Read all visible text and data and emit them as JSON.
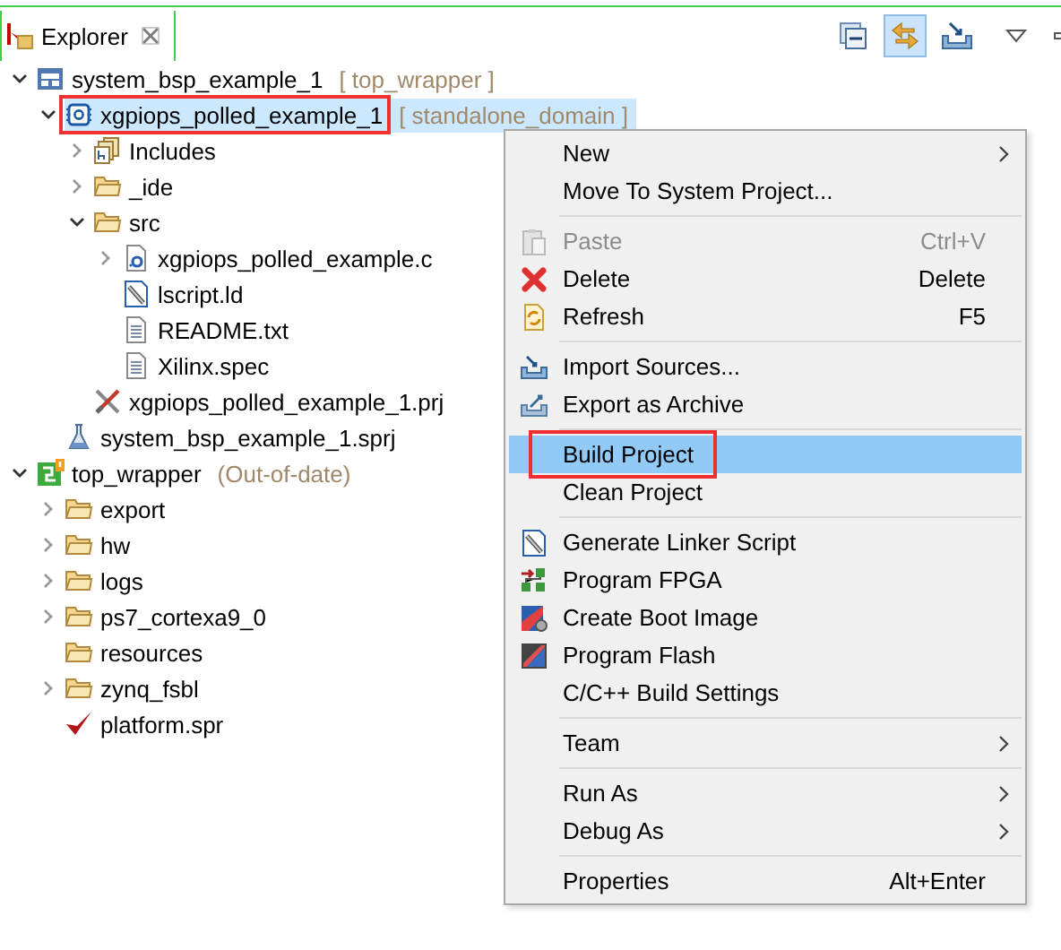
{
  "view_tab": {
    "title": "Explorer",
    "selected": true
  },
  "toolbar": [
    {
      "kind": "collapse",
      "selected": false
    },
    {
      "kind": "link",
      "selected": true
    },
    {
      "kind": "import",
      "selected": false
    },
    {
      "kind": "view-menu",
      "selected": false
    },
    {
      "kind": "minimize",
      "selected": false
    }
  ],
  "tree": [
    {
      "label": "system_bsp_example_1",
      "suffix": "[ top_wrapper ]",
      "kind": "system",
      "expanded": true,
      "selected": false,
      "boxed": false,
      "children": [
        {
          "label": "xgpiops_polled_example_1",
          "suffix": "[ standalone_domain ]",
          "kind": "app",
          "expanded": true,
          "selected": true,
          "boxed": true,
          "children": [
            {
              "label": "Includes",
              "kind": "includes",
              "expanded": false,
              "selected": false,
              "boxed": false
            },
            {
              "label": "_ide",
              "kind": "folder",
              "expanded": false,
              "selected": false,
              "boxed": false
            },
            {
              "label": "src",
              "kind": "folder",
              "expanded": true,
              "selected": false,
              "boxed": false,
              "children": [
                {
                  "label": "xgpiops_polled_example.c",
                  "kind": "c-file",
                  "expanded": false,
                  "selected": false,
                  "boxed": false
                },
                {
                  "label": "lscript.ld",
                  "kind": "linker",
                  "selected": false,
                  "boxed": false
                },
                {
                  "label": "README.txt",
                  "kind": "text",
                  "selected": false,
                  "boxed": false
                },
                {
                  "label": "Xilinx.spec",
                  "kind": "text",
                  "selected": false,
                  "boxed": false
                }
              ]
            },
            {
              "label": "xgpiops_polled_example_1.prj",
              "kind": "tools",
              "selected": false,
              "boxed": false
            }
          ]
        },
        {
          "label": "system_bsp_example_1.sprj",
          "kind": "flask",
          "selected": false,
          "boxed": false
        }
      ]
    },
    {
      "label": "top_wrapper",
      "suffix": "(Out-of-date)",
      "kind": "platform",
      "expanded": true,
      "selected": false,
      "boxed": false,
      "children": [
        {
          "label": "export",
          "kind": "folder",
          "expanded": false,
          "selected": false,
          "boxed": false
        },
        {
          "label": "hw",
          "kind": "folder",
          "expanded": false,
          "selected": false,
          "boxed": false
        },
        {
          "label": "logs",
          "kind": "folder",
          "expanded": false,
          "selected": false,
          "boxed": false
        },
        {
          "label": "ps7_cortexa9_0",
          "kind": "folder",
          "expanded": false,
          "selected": false,
          "boxed": false
        },
        {
          "label": "resources",
          "kind": "folder",
          "selected": false,
          "boxed": false
        },
        {
          "label": "zynq_fsbl",
          "kind": "folder",
          "expanded": false,
          "selected": false,
          "boxed": false
        },
        {
          "label": "platform.spr",
          "kind": "check",
          "selected": false,
          "boxed": false
        }
      ]
    }
  ],
  "context_menu": {
    "sections": [
      [
        {
          "label": "New",
          "kind": "none",
          "submenu": true,
          "disabled": false,
          "selected": false,
          "boxed": false
        },
        {
          "label": "Move To System Project...",
          "kind": "none",
          "submenu": false,
          "disabled": false,
          "selected": false,
          "boxed": false
        }
      ],
      [
        {
          "label": "Paste",
          "shortcut": "Ctrl+V",
          "kind": "paste",
          "submenu": false,
          "disabled": true,
          "selected": false,
          "boxed": false
        },
        {
          "label": "Delete",
          "shortcut": "Delete",
          "kind": "delete",
          "submenu": false,
          "disabled": false,
          "selected": false,
          "boxed": false
        },
        {
          "label": "Refresh",
          "shortcut": "F5",
          "kind": "refresh",
          "submenu": false,
          "disabled": false,
          "selected": false,
          "boxed": false
        }
      ],
      [
        {
          "label": "Import Sources...",
          "kind": "import",
          "submenu": false,
          "disabled": false,
          "selected": false,
          "boxed": false
        },
        {
          "label": "Export as Archive",
          "kind": "export",
          "submenu": false,
          "disabled": false,
          "selected": false,
          "boxed": false
        }
      ],
      [
        {
          "label": "Build Project",
          "kind": "none",
          "submenu": false,
          "disabled": false,
          "selected": true,
          "boxed": true
        },
        {
          "label": "Clean Project",
          "kind": "none",
          "submenu": false,
          "disabled": false,
          "selected": false,
          "boxed": false
        }
      ],
      [
        {
          "label": "Generate Linker Script",
          "kind": "linker",
          "submenu": false,
          "disabled": false,
          "selected": false,
          "boxed": false
        },
        {
          "label": "Program FPGA",
          "kind": "fpga",
          "submenu": false,
          "disabled": false,
          "selected": false,
          "boxed": false
        },
        {
          "label": "Create Boot Image",
          "kind": "boot",
          "submenu": false,
          "disabled": false,
          "selected": false,
          "boxed": false
        },
        {
          "label": "Program Flash",
          "kind": "flash",
          "submenu": false,
          "disabled": false,
          "selected": false,
          "boxed": false
        },
        {
          "label": "C/C++ Build Settings",
          "kind": "none",
          "submenu": false,
          "disabled": false,
          "selected": false,
          "boxed": false
        }
      ],
      [
        {
          "label": "Team",
          "kind": "none",
          "submenu": true,
          "disabled": false,
          "selected": false,
          "boxed": false
        }
      ],
      [
        {
          "label": "Run As",
          "kind": "none",
          "submenu": true,
          "disabled": false,
          "selected": false,
          "boxed": false
        },
        {
          "label": "Debug As",
          "kind": "none",
          "submenu": true,
          "disabled": false,
          "selected": false,
          "boxed": false
        }
      ],
      [
        {
          "label": "Properties",
          "shortcut": "Alt+Enter",
          "kind": "none",
          "submenu": false,
          "disabled": false,
          "selected": false,
          "boxed": false
        }
      ]
    ]
  }
}
